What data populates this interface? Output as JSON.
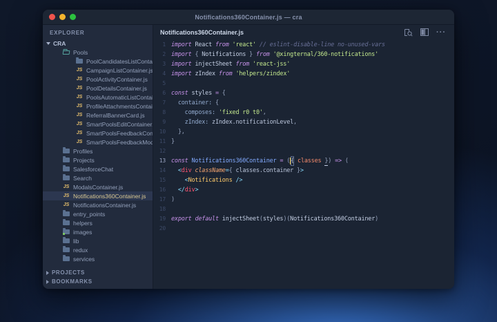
{
  "window": {
    "title": "Notifications360Container.js — cra"
  },
  "colors": {
    "editor_bg": "#1b2433",
    "sidebar_bg": "#222b3d",
    "titlebar_bg": "#1d2634",
    "accent_keyword": "#c792ea",
    "accent_string": "#c3e88d",
    "accent_tag": "#ff5572",
    "accent_component": "#ffcb6b",
    "accent_param": "#f78c6c",
    "accent_function": "#82aaff",
    "accent_jsx_punct": "#89ddff",
    "selected_file_text": "#d9c893",
    "js_badge": "#e6bf6c",
    "traffic_red": "#f2544d",
    "traffic_yellow": "#f5b52e",
    "traffic_green": "#2cc23f",
    "cursor": "#ffd24a"
  },
  "sidebar": {
    "explorer_label": "EXPLORER",
    "root_label": "CRA",
    "items": [
      {
        "label": "Pools",
        "type": "folder-open",
        "level": 1
      },
      {
        "label": "PoolCandidatesListContain…",
        "type": "folder",
        "level": 2
      },
      {
        "label": "CampaignListContainer.js",
        "type": "js",
        "level": 2
      },
      {
        "label": "PoolActivityContainer.js",
        "type": "js",
        "level": 2
      },
      {
        "label": "PoolDetailsContainer.js",
        "type": "js",
        "level": 2
      },
      {
        "label": "PoolsAutomaticListContain…",
        "type": "js",
        "level": 2
      },
      {
        "label": "ProfileAttachmentsContain…",
        "type": "js",
        "level": 2
      },
      {
        "label": "ReferralBannerCard.js",
        "type": "js",
        "level": 2
      },
      {
        "label": "SmartPoolsEditContainer.js",
        "type": "js",
        "level": 2
      },
      {
        "label": "SmartPoolsFeedbackConta…",
        "type": "js",
        "level": 2
      },
      {
        "label": "SmartPoolsFeedbackModa…",
        "type": "js",
        "level": 2
      },
      {
        "label": "Profiles",
        "type": "folder",
        "level": 1
      },
      {
        "label": "Projects",
        "type": "folder",
        "level": 1
      },
      {
        "label": "SalesforceChat",
        "type": "folder",
        "level": 1
      },
      {
        "label": "Search",
        "type": "folder",
        "level": 1
      },
      {
        "label": "ModalsContainer.js",
        "type": "js",
        "level": 1
      },
      {
        "label": "Notifications360Container.js",
        "type": "js",
        "level": 1,
        "selected": true
      },
      {
        "label": "NotificationsContainer.js",
        "type": "js",
        "level": 1
      },
      {
        "label": "entry_points",
        "type": "folder",
        "level": 1
      },
      {
        "label": "helpers",
        "type": "folder",
        "level": 1
      },
      {
        "label": "images",
        "type": "folder",
        "level": 1,
        "dot": true
      },
      {
        "label": "lib",
        "type": "folder",
        "level": 1
      },
      {
        "label": "redux",
        "type": "folder",
        "level": 1
      },
      {
        "label": "services",
        "type": "folder",
        "level": 1
      }
    ],
    "sections": [
      {
        "label": "PROJECTS"
      },
      {
        "label": "BOOKMARKS"
      }
    ]
  },
  "editor": {
    "tab_label": "Notifications360Container.js",
    "more_actions_glyph": "···",
    "lines": [
      {
        "n": 1,
        "tokens": [
          [
            "kw",
            "import"
          ],
          [
            "tx",
            " "
          ],
          [
            "id",
            "React"
          ],
          [
            "tx",
            " "
          ],
          [
            "kw",
            "from"
          ],
          [
            "tx",
            " "
          ],
          [
            "st",
            "'react'"
          ],
          [
            "tx",
            " "
          ],
          [
            "cm",
            "// eslint-disable-line no-unused-vars"
          ]
        ]
      },
      {
        "n": 2,
        "tokens": [
          [
            "kw",
            "import"
          ],
          [
            "tx",
            " "
          ],
          [
            "pn",
            "{ "
          ],
          [
            "id",
            "Notifications"
          ],
          [
            "pn",
            " } "
          ],
          [
            "kw",
            "from"
          ],
          [
            "tx",
            " "
          ],
          [
            "st",
            "'@xingternal/360-notifications'"
          ]
        ]
      },
      {
        "n": 3,
        "tokens": [
          [
            "kw",
            "import"
          ],
          [
            "tx",
            " "
          ],
          [
            "id",
            "injectSheet"
          ],
          [
            "tx",
            " "
          ],
          [
            "kw",
            "from"
          ],
          [
            "tx",
            " "
          ],
          [
            "st",
            "'react-jss'"
          ]
        ]
      },
      {
        "n": 4,
        "tokens": [
          [
            "kw",
            "import"
          ],
          [
            "tx",
            " "
          ],
          [
            "id",
            "zIndex"
          ],
          [
            "tx",
            " "
          ],
          [
            "kw",
            "from"
          ],
          [
            "tx",
            " "
          ],
          [
            "st",
            "'helpers/zindex'"
          ]
        ]
      },
      {
        "n": 5,
        "tokens": []
      },
      {
        "n": 6,
        "tokens": [
          [
            "kw",
            "const"
          ],
          [
            "tx",
            " "
          ],
          [
            "id",
            "styles"
          ],
          [
            "op",
            " = "
          ],
          [
            "pn",
            "{"
          ]
        ]
      },
      {
        "n": 7,
        "tokens": [
          [
            "tx",
            "  "
          ],
          [
            "pr",
            "container:"
          ],
          [
            "tx",
            " "
          ],
          [
            "pn",
            "{"
          ]
        ]
      },
      {
        "n": 8,
        "tokens": [
          [
            "tx",
            "    "
          ],
          [
            "pr",
            "composes:"
          ],
          [
            "tx",
            " "
          ],
          [
            "st",
            "'fixed r0 t0'"
          ],
          [
            "pn",
            ","
          ]
        ]
      },
      {
        "n": 9,
        "tokens": [
          [
            "tx",
            "    "
          ],
          [
            "pr",
            "zIndex:"
          ],
          [
            "tx",
            " zIndex.notificationLevel"
          ],
          [
            "pn",
            ","
          ]
        ]
      },
      {
        "n": 10,
        "tokens": [
          [
            "tx",
            "  "
          ],
          [
            "pn",
            "},"
          ]
        ]
      },
      {
        "n": 11,
        "tokens": [
          [
            "pn",
            "}"
          ]
        ]
      },
      {
        "n": 12,
        "tokens": []
      },
      {
        "n": 13,
        "active": true,
        "tokens": [
          [
            "kw",
            "const"
          ],
          [
            "tx",
            " "
          ],
          [
            "fn",
            "Notifications360Container"
          ],
          [
            "op",
            " = "
          ],
          [
            "pn",
            "("
          ],
          [
            "caret",
            ""
          ],
          [
            "bm",
            "{"
          ],
          [
            "tx",
            " "
          ],
          [
            "pm",
            "classes"
          ],
          [
            "tx",
            " "
          ],
          [
            "ul",
            "}"
          ],
          [
            "pn",
            ")"
          ],
          [
            "op",
            " =>"
          ],
          [
            "tx",
            " "
          ],
          [
            "pn",
            "("
          ]
        ]
      },
      {
        "n": 14,
        "tokens": [
          [
            "tx",
            "  "
          ],
          [
            "cy",
            "<"
          ],
          [
            "tg",
            "div"
          ],
          [
            "tx",
            " "
          ],
          [
            "at",
            "className"
          ],
          [
            "cy",
            "="
          ],
          [
            "pn",
            "{"
          ],
          [
            "tx",
            " classes.container "
          ],
          [
            "pn",
            "}"
          ],
          [
            "cy",
            ">"
          ]
        ]
      },
      {
        "n": 15,
        "tokens": [
          [
            "tx",
            "    "
          ],
          [
            "cy",
            "<"
          ],
          [
            "cp",
            "Notifications"
          ],
          [
            "tx",
            " "
          ],
          [
            "cy",
            "/>"
          ]
        ]
      },
      {
        "n": 16,
        "tokens": [
          [
            "tx",
            "  "
          ],
          [
            "cy",
            "</"
          ],
          [
            "tg",
            "div"
          ],
          [
            "cy",
            ">"
          ]
        ]
      },
      {
        "n": 17,
        "tokens": [
          [
            "pn",
            ")"
          ]
        ]
      },
      {
        "n": 18,
        "tokens": []
      },
      {
        "n": 19,
        "tokens": [
          [
            "kw",
            "export"
          ],
          [
            "tx",
            " "
          ],
          [
            "kw",
            "default"
          ],
          [
            "tx",
            " "
          ],
          [
            "id",
            "injectSheet"
          ],
          [
            "pn",
            "("
          ],
          [
            "id",
            "styles"
          ],
          [
            "pn",
            ")("
          ],
          [
            "id",
            "Notifications360Container"
          ],
          [
            "pn",
            ")"
          ]
        ]
      },
      {
        "n": 20,
        "tokens": []
      }
    ]
  }
}
